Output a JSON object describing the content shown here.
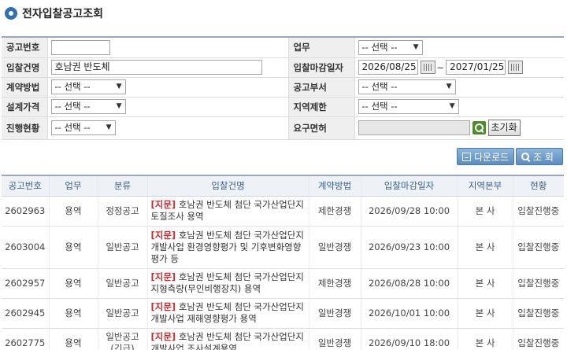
{
  "page": {
    "title": "전자입찰공고조회"
  },
  "search": {
    "notice_no": {
      "label": "공고번호",
      "value": ""
    },
    "work": {
      "label": "업무",
      "value": "-- 선택 --"
    },
    "bid_name": {
      "label": "입찰건명",
      "value": "호남권 반도체"
    },
    "deadline": {
      "label": "입찰마감일자",
      "from": "2026/08/25",
      "sep": "~",
      "to": "2027/01/25"
    },
    "contract_method": {
      "label": "계약방법",
      "value": "-- 선택 --"
    },
    "notice_dept": {
      "label": "공고부서",
      "value": "-- 선택 --"
    },
    "design_price": {
      "label": "설계가격",
      "value": "-- 선택 --"
    },
    "region": {
      "label": "지역제한",
      "value": "-- 선택 --"
    },
    "status": {
      "label": "진행현황",
      "value": "-- 선택 --"
    },
    "license": {
      "label": "요구면허",
      "value": ""
    },
    "reset_label": "초기화"
  },
  "actions": {
    "download_label": "다운로드",
    "search_label": "조 회"
  },
  "results": {
    "headers": [
      "공고번호",
      "업무",
      "분류",
      "입찰건명",
      "계약방법",
      "입찰마감일자",
      "지역본부",
      "현황"
    ],
    "rows": [
      {
        "no": "2602963",
        "work": "용역",
        "cls": "정정공고",
        "cls2": "",
        "tag": "[지문]",
        "name1": " 호남권 반도체 첨단 국가산업단지",
        "name2": "토질조사 용역",
        "name3": "",
        "method": "제한경쟁",
        "deadline": "2026/09/28 10:00",
        "region": "본 사",
        "status": "입찰진행중"
      },
      {
        "no": "2603004",
        "work": "용역",
        "cls": "일반공고",
        "cls2": "",
        "tag": "[지문]",
        "name1": " 호남권 반도체 첨단 국가산업단지",
        "name2": "개발사업 환경영향평가 및 기후변화영향",
        "name3": "평가 등",
        "method": "일반경쟁",
        "deadline": "2026/09/23 10:00",
        "region": "본 사",
        "status": "입찰진행중"
      },
      {
        "no": "2602957",
        "work": "용역",
        "cls": "일반공고",
        "cls2": "",
        "tag": "[지문]",
        "name1": " 호남권 반도체 첨단 국가산업단지",
        "name2": "지형측량(무인비행장치) 용역",
        "name3": "",
        "method": "제한경쟁",
        "deadline": "2026/08/28 10:00",
        "region": "본 사",
        "status": "입찰진행중"
      },
      {
        "no": "2602945",
        "work": "용역",
        "cls": "일반공고",
        "cls2": "",
        "tag": "[지문]",
        "name1": " 호남권 반도체 첨단 국가산업단지",
        "name2": "개발사업 재해영향평가 용역",
        "name3": "",
        "method": "일반경쟁",
        "deadline": "2026/10/01 10:00",
        "region": "본 사",
        "status": "입찰진행중"
      },
      {
        "no": "2602775",
        "work": "용역",
        "cls": "일반공고",
        "cls2": "(긴급)",
        "tag": "[지문]",
        "name1": " 호남권 반도체 첨단 국가산업단지",
        "name2": "개발사업 조사설계용역",
        "name3": "",
        "method": "일반경쟁",
        "deadline": "2026/09/10 18:00",
        "region": "본 사",
        "status": "입찰진행중"
      }
    ]
  }
}
